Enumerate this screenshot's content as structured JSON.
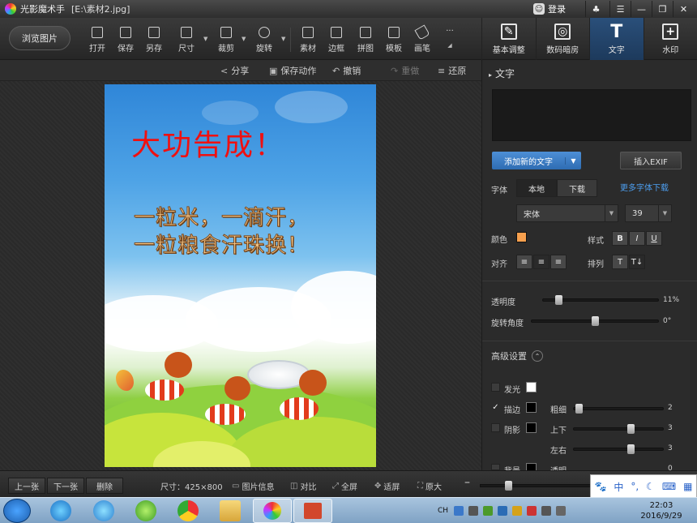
{
  "window": {
    "app_title": "光影魔术手",
    "file_title": "[E:\\素材2.jpg]",
    "login_label": "登录"
  },
  "toolbar": {
    "browse_label": "浏览图片",
    "tools": [
      {
        "label": "打开",
        "icon": "open-icon"
      },
      {
        "label": "保存",
        "icon": "save-icon"
      },
      {
        "label": "另存",
        "icon": "save-as-icon"
      },
      {
        "label": "尺寸",
        "icon": "resize-icon"
      },
      {
        "label": "裁剪",
        "icon": "crop-icon"
      },
      {
        "label": "旋转",
        "icon": "rotate-icon"
      },
      {
        "label": "素材",
        "icon": "material-icon"
      },
      {
        "label": "边框",
        "icon": "border-icon"
      },
      {
        "label": "拼图",
        "icon": "collage-icon"
      },
      {
        "label": "模板",
        "icon": "template-icon"
      },
      {
        "label": "画笔",
        "icon": "brush-icon"
      }
    ],
    "more_label": "···"
  },
  "right_tabs": [
    {
      "label": "基本调整",
      "icon": "basic-adjust-icon"
    },
    {
      "label": "数码暗房",
      "icon": "darkroom-icon"
    },
    {
      "label": "文字",
      "icon": "text-icon",
      "active": true
    },
    {
      "label": "水印",
      "icon": "watermark-icon"
    }
  ],
  "actionbar": {
    "share": "分享",
    "save_action": "保存动作",
    "undo": "撤销",
    "redo": "重做",
    "restore": "还原"
  },
  "photo": {
    "title": "大功告成！",
    "line1": "一粒米，一滴汗，",
    "line2": "一粒粮食汗珠换！"
  },
  "panel": {
    "section_title": "文字",
    "add_text": "添加新的文字",
    "insert_exif": "插入EXIF",
    "font_label": "字体",
    "local_label": "本地",
    "download_label": "下载",
    "more_fonts": "更多字体下载",
    "font_name": "宋体",
    "font_size": "39",
    "color_label": "颜色",
    "style_label": "样式",
    "bold": "B",
    "italic": "I",
    "underline": "U",
    "align_label": "对齐",
    "arrange_label": "排列",
    "opacity_label": "透明度",
    "opacity_value": "11%",
    "opacity_level": 0.11,
    "rotation_label": "旋转角度",
    "rotation_value": "0°",
    "advanced_label": "高级设置",
    "glow_label": "发光",
    "stroke_label": "描边",
    "thickness_label": "粗细",
    "thickness_value": "2",
    "shadow_label": "阴影",
    "updown_label": "上下",
    "updown_value": "3",
    "leftright_label": "左右",
    "leftright_value": "3",
    "bg_label": "背景",
    "transparent_label": "透明",
    "transparent_value": "0",
    "text_color": "#f7a04e"
  },
  "bottombar": {
    "prev": "上一张",
    "next": "下一张",
    "delete": "删除",
    "size_info": "尺寸：425×800",
    "image_info": "图片信息",
    "compare": "对比",
    "fullscreen": "全屏",
    "fit": "适屏",
    "original": "原大"
  },
  "ime": {
    "lang": "中"
  },
  "taskbar": {
    "lang": "CH",
    "time": "22:03",
    "date": "2016/9/29"
  }
}
